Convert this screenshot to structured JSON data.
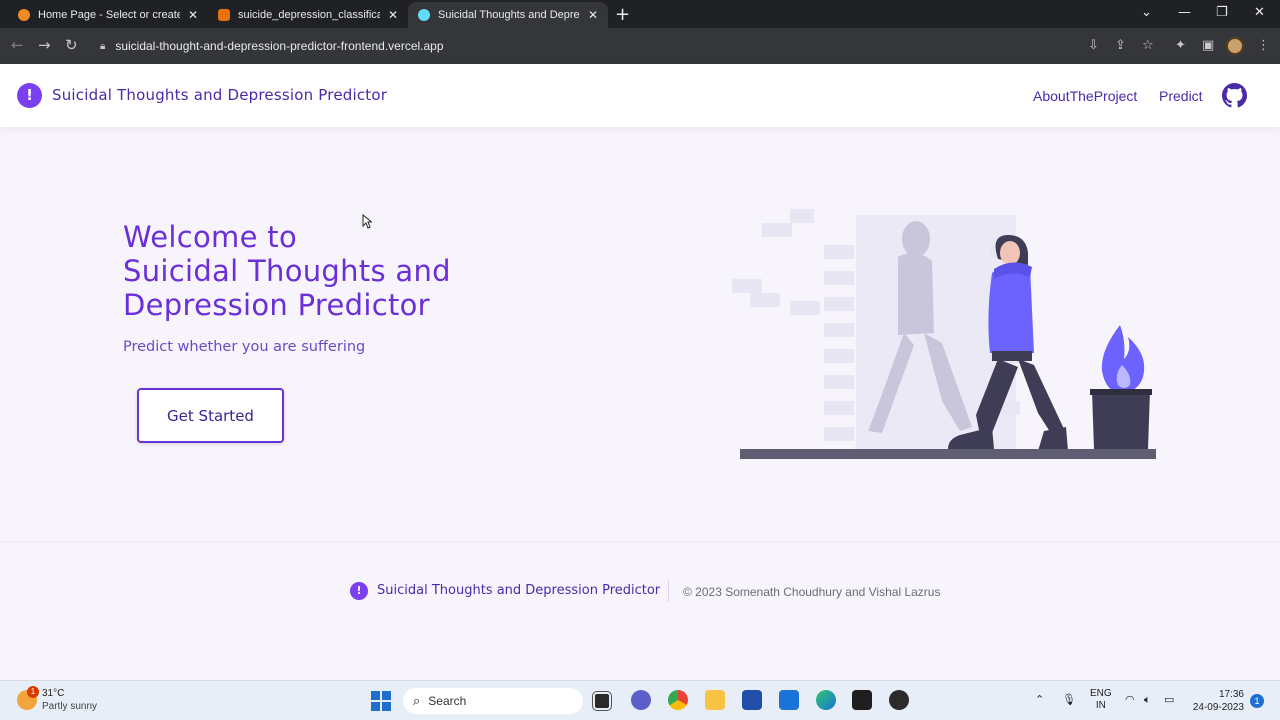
{
  "browser": {
    "tabs": [
      {
        "title": "Home Page - Select or create a n",
        "active": false,
        "favicon_color": "#f08a24"
      },
      {
        "title": "suicide_depression_classification",
        "active": false,
        "favicon_color": "#e8710a"
      },
      {
        "title": "Suicidal Thoughts and Depressio",
        "active": true,
        "favicon_color": "#61dafb"
      }
    ],
    "url": "suicidal-thought-and-depression-predictor-frontend.vercel.app"
  },
  "header": {
    "brand_icon": "!",
    "brand_title": "Suicidal Thoughts and Depression Predictor",
    "nav": [
      {
        "label": "AboutTheProject"
      },
      {
        "label": "Predict"
      }
    ]
  },
  "hero": {
    "title_line1": "Welcome to",
    "title_line2": "Suicidal Thoughts and",
    "title_line3": "Depression Predictor",
    "subtitle": "Predict whether you are suffering",
    "cta_label": "Get Started"
  },
  "footer": {
    "brand_icon": "!",
    "brand_title": "Suicidal Thoughts and Depression Predictor",
    "copyright": "© 2023 Somenath Choudhury and Vishal Lazrus"
  },
  "taskbar": {
    "weather_badge": "1",
    "temperature": "31°C",
    "condition": "Partly sunny",
    "search_placeholder": "Search",
    "lang_line1": "ENG",
    "lang_line2": "IN",
    "time": "17:36",
    "date": "24-09-2023",
    "notification_count": "1"
  },
  "colors": {
    "brand_purple": "#7a3ff0",
    "heading_purple": "#6a2fd8",
    "page_background": "#f7f5fb"
  }
}
